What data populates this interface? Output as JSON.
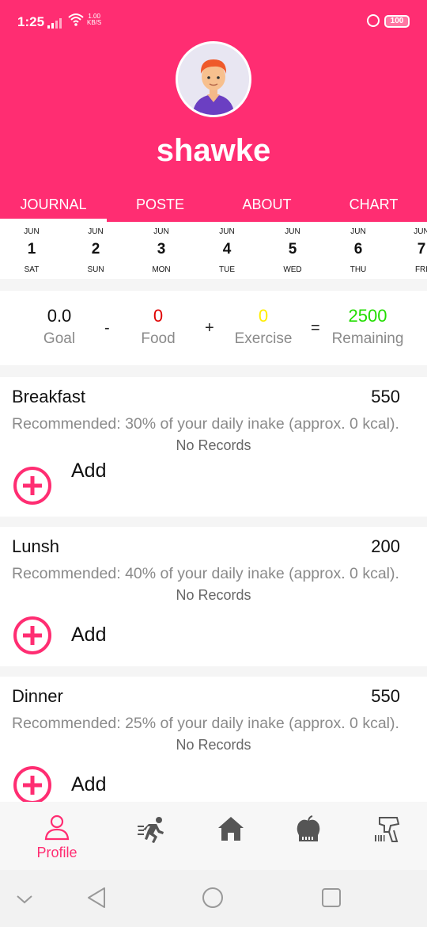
{
  "status_bar": {
    "time": "1:25",
    "net_speed_value": "1.00",
    "net_speed_unit": "KB/S",
    "battery": "100",
    "icons": [
      "signal-icon",
      "wifi-icon",
      "lock-icon",
      "battery-icon"
    ]
  },
  "profile": {
    "username": "shawke",
    "avatar_icon": "person-avatar-icon"
  },
  "colors": {
    "primary": "#ff2d72",
    "food": "#e00000",
    "exercise": "#ffee00",
    "remaining": "#22dd00"
  },
  "tabs": [
    {
      "label": "JOURNAL",
      "active": true
    },
    {
      "label": "POSTE",
      "active": false
    },
    {
      "label": "ABOUT",
      "active": false
    },
    {
      "label": "CHART",
      "active": false
    }
  ],
  "dates": [
    {
      "month": "JUN",
      "day": "1",
      "dow": "SAT"
    },
    {
      "month": "JUN",
      "day": "2",
      "dow": "SUN"
    },
    {
      "month": "JUN",
      "day": "3",
      "dow": "MON"
    },
    {
      "month": "JUN",
      "day": "4",
      "dow": "TUE"
    },
    {
      "month": "JUN",
      "day": "5",
      "dow": "WED"
    },
    {
      "month": "JUN",
      "day": "6",
      "dow": "THU"
    },
    {
      "month": "JUN",
      "day": "7",
      "dow": "FRI"
    }
  ],
  "summary": {
    "goal": {
      "value": "0.0",
      "label": "Goal"
    },
    "minus": "-",
    "food": {
      "value": "0",
      "label": "Food"
    },
    "plus": "+",
    "exercise": {
      "value": "0",
      "label": "Exercise"
    },
    "equals": "=",
    "remaining": {
      "value": "2500",
      "label": "Remaining"
    }
  },
  "meals": [
    {
      "title": "Breakfast",
      "calories": "550",
      "recommendation": "Recommended: 30% of your daily inake (approx. 0 kcal).",
      "empty_text": "No Records",
      "add_label": "Add"
    },
    {
      "title": "Lunsh",
      "calories": "200",
      "recommendation": "Recommended: 40% of your daily inake (approx. 0 kcal).",
      "empty_text": "No Records",
      "add_label": "Add"
    },
    {
      "title": "Dinner",
      "calories": "550",
      "recommendation": "Recommended: 25% of your daily inake (approx. 0 kcal).",
      "empty_text": "No Records",
      "add_label": "Add"
    }
  ],
  "bottom_nav": {
    "profile_label": "Profile",
    "icons": [
      "profile-icon",
      "running-icon",
      "home-icon",
      "apple-scale-icon",
      "barcode-scanner-icon"
    ]
  },
  "system_nav": {
    "icons": [
      "chevron-down-icon",
      "back-icon",
      "home-circle-icon",
      "recents-icon"
    ]
  }
}
